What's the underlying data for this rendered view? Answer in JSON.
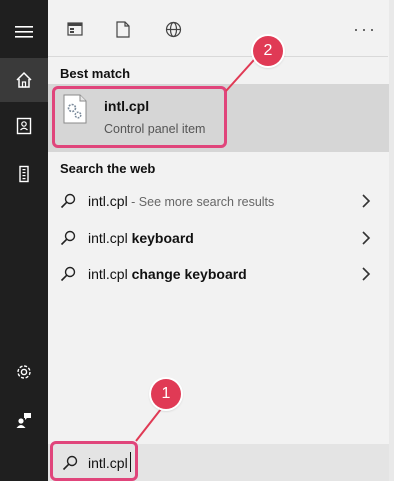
{
  "toolbar": {
    "icons": [
      "apps-icon",
      "document-icon",
      "globe-icon"
    ],
    "more_label": "···"
  },
  "sections": {
    "best_match": "Best match",
    "search_web": "Search the web"
  },
  "best_match_item": {
    "title": "intl.cpl",
    "subtitle": "Control panel item"
  },
  "web_results": [
    {
      "query": "intl.cpl",
      "suffix": " - See more search results"
    },
    {
      "query": "intl.cpl",
      "bold_suffix": " keyboard"
    },
    {
      "query": "intl.cpl",
      "bold_suffix": " change keyboard"
    }
  ],
  "search": {
    "value": "intl.cpl"
  },
  "callouts": {
    "one": "1",
    "two": "2"
  },
  "colors": {
    "rail": "#1f1f1f",
    "highlight": "#e0457b",
    "selection": "#d6d6d6"
  }
}
